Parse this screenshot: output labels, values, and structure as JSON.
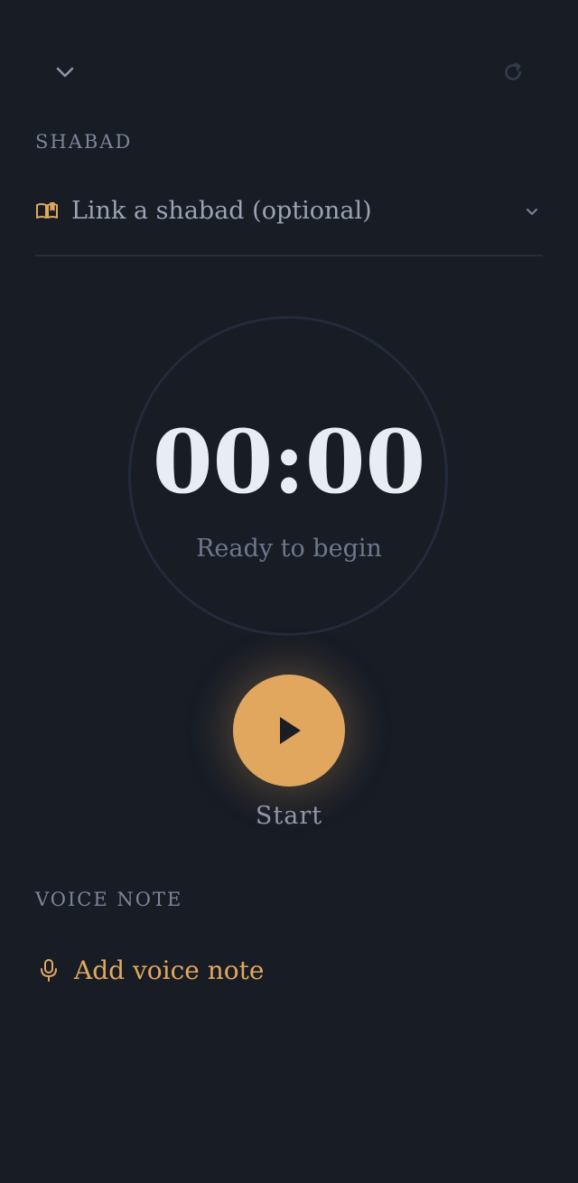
{
  "header": {
    "collapse_icon": "chevron-down-icon",
    "reset_icon": "refresh-icon"
  },
  "shabad": {
    "section_label": "SHABAD",
    "picker_placeholder": "Link a shabad (optional)",
    "icon": "book-open-icon"
  },
  "timer": {
    "value": "00:00",
    "status": "Ready to begin"
  },
  "controls": {
    "start_label": "Start",
    "accent_color": "#e1a75f"
  },
  "voice_note": {
    "section_label": "VOICE NOTE",
    "action_label": "Add voice note",
    "icon": "microphone-icon"
  },
  "colors": {
    "background": "#171c25",
    "text_primary": "#e8edf4",
    "text_muted": "#7c8599",
    "accent": "#e1a75f"
  }
}
